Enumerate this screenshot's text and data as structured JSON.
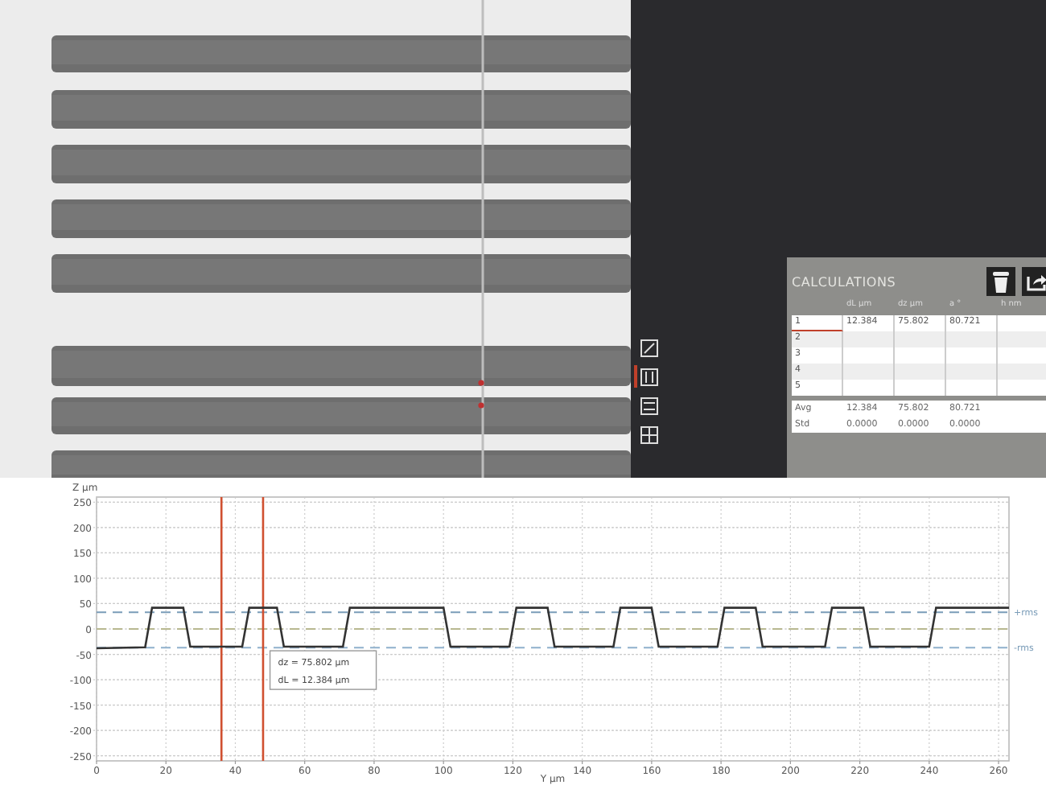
{
  "tools": [
    {
      "kind": "diagonal",
      "selected": false
    },
    {
      "kind": "vertical",
      "selected": true
    },
    {
      "kind": "horizontal",
      "selected": false
    },
    {
      "kind": "grid",
      "selected": false
    }
  ],
  "calculations": {
    "title": "CALCULATIONS",
    "columns": [
      "dL µm",
      "dz µm",
      "a °",
      "h nm"
    ],
    "rows": [
      {
        "index": "1",
        "selected": true,
        "cells": [
          "12.384",
          "75.802",
          "80.721"
        ]
      },
      {
        "index": "2",
        "selected": false
      },
      {
        "index": "3",
        "selected": false
      },
      {
        "index": "4",
        "selected": false
      },
      {
        "index": "5",
        "selected": false
      }
    ],
    "summary": [
      {
        "label": "Avg",
        "cells": [
          "12.384",
          "75.802",
          "80.721"
        ]
      },
      {
        "label": "Std",
        "cells": [
          "0.0000",
          "0.0000",
          "0.0000"
        ]
      }
    ]
  },
  "profile": {
    "chart_data": {
      "type": "line",
      "xlabel": "Y µm",
      "ylabel": "Z µm",
      "xlim": [
        0,
        263
      ],
      "ylim": [
        -260,
        260
      ],
      "xticks": [
        0,
        20,
        40,
        60,
        80,
        100,
        120,
        140,
        160,
        180,
        200,
        220,
        240,
        260
      ],
      "yticks": [
        -250,
        -200,
        -150,
        -100,
        -50,
        0,
        50,
        100,
        150,
        200,
        250
      ],
      "x": [
        0,
        14,
        16,
        25,
        27,
        42,
        44,
        52,
        54,
        71,
        73,
        100,
        102,
        119,
        121,
        130,
        132,
        149,
        151,
        160,
        162,
        179,
        181,
        190,
        192,
        210,
        212,
        221,
        223,
        240,
        242,
        263
      ],
      "grid": true,
      "series": [
        {
          "color": "#333333",
          "values": [
            -38,
            -36,
            42,
            42,
            -35,
            -35,
            42,
            42,
            -35,
            -35,
            42,
            42,
            -35,
            -35,
            42,
            42,
            -35,
            -35,
            42,
            42,
            -35,
            -35,
            42,
            42,
            -35,
            -35,
            42,
            42,
            -35,
            -35,
            42,
            42
          ]
        }
      ],
      "ref_lines": [
        {
          "axis": "y",
          "value": 33,
          "label": "+rms"
        },
        {
          "axis": "y",
          "value": 0
        },
        {
          "axis": "y",
          "value": -37,
          "label": "-rms"
        },
        {
          "axis": "x",
          "value": 36
        },
        {
          "axis": "x",
          "value": 48
        }
      ],
      "annotations": [
        {
          "text": "dz = 75.802 µm"
        },
        {
          "text": "dL = 12.384 µm"
        }
      ]
    }
  }
}
